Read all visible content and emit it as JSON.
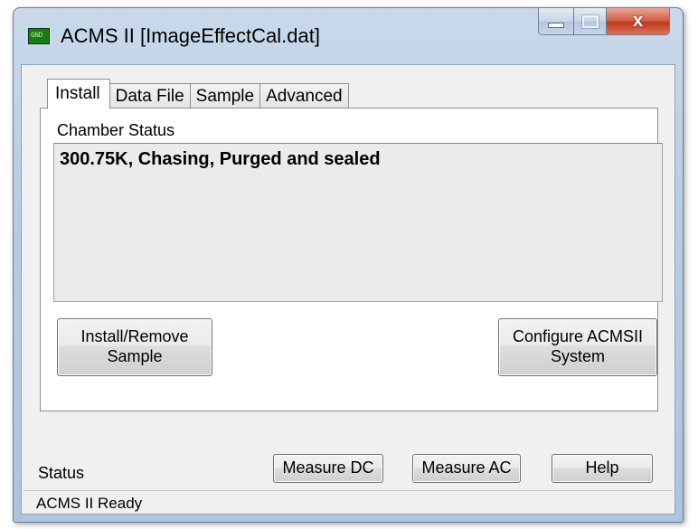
{
  "window": {
    "title": "ACMS II  [ImageEffectCal.dat]",
    "icon_text": "GND",
    "caption_buttons": {
      "minimize": "minimize",
      "maximize": "maximize",
      "close": "x"
    }
  },
  "tabs": [
    {
      "label": "Install",
      "active": true
    },
    {
      "label": "Data File",
      "active": false
    },
    {
      "label": "Sample",
      "active": false
    },
    {
      "label": "Advanced",
      "active": false
    }
  ],
  "install_tab": {
    "chamber_status_label": "Chamber Status",
    "chamber_status_value": "300.75K, Chasing, Purged and sealed",
    "install_remove_button": "Install/Remove\nSample",
    "configure_button": "Configure ACMSII\nSystem"
  },
  "footer": {
    "status_label": "Status",
    "measure_dc_button": "Measure DC",
    "measure_ac_button": "Measure AC",
    "help_button": "Help"
  },
  "status_bar": {
    "text": "ACMS II Ready"
  },
  "icons": {
    "app": "gnd-app-icon",
    "minimize": "minimize-icon",
    "maximize": "maximize-icon",
    "close": "close-icon"
  },
  "colors": {
    "title_bar": "#b8cde3",
    "close_button": "#c0391c",
    "client_background": "#f0f0f0",
    "chamber_box": "#ebebeb"
  }
}
